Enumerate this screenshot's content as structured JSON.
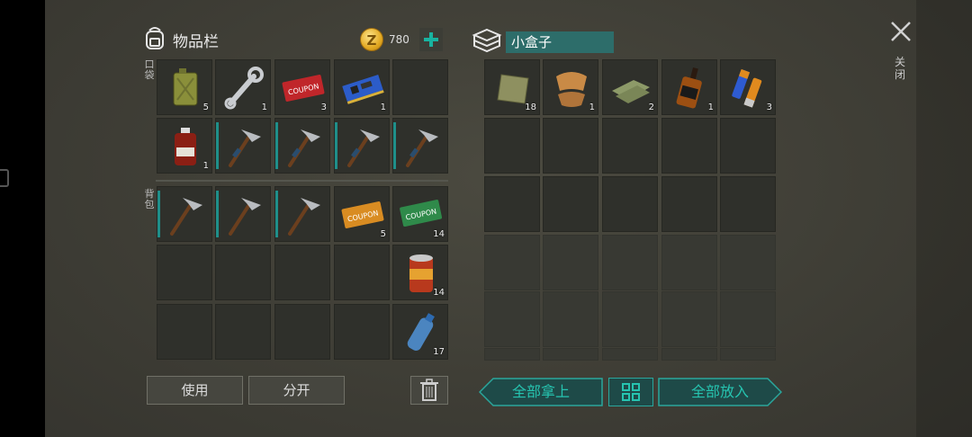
{
  "inventory": {
    "title": "物品栏",
    "coins": "780",
    "pocket_label": "口袋",
    "backpack_label": "背包",
    "use_button": "使用",
    "split_button": "分开"
  },
  "container": {
    "name": "小盒子",
    "take_all_button": "全部拿上",
    "put_all_button": "全部放入"
  },
  "close_label": "关闭",
  "slots": {
    "jerrycan": "5",
    "wrench": "1",
    "red_coupon": "3",
    "circuit_board": "1",
    "medicine_bottle": "1",
    "orange_coupon": "5",
    "green_coupon": "14",
    "canned_food": "14",
    "water_bottle": "17",
    "cloth_square": "18",
    "leather_hide": "1",
    "cloth_pile": "2",
    "whiskey_bottle": "1",
    "batteries": "3"
  },
  "coupon_text": "COUPON",
  "colors": {
    "accent": "#26c4b0",
    "teal_dark": "#1e4a48",
    "gold": "#e3a922"
  }
}
